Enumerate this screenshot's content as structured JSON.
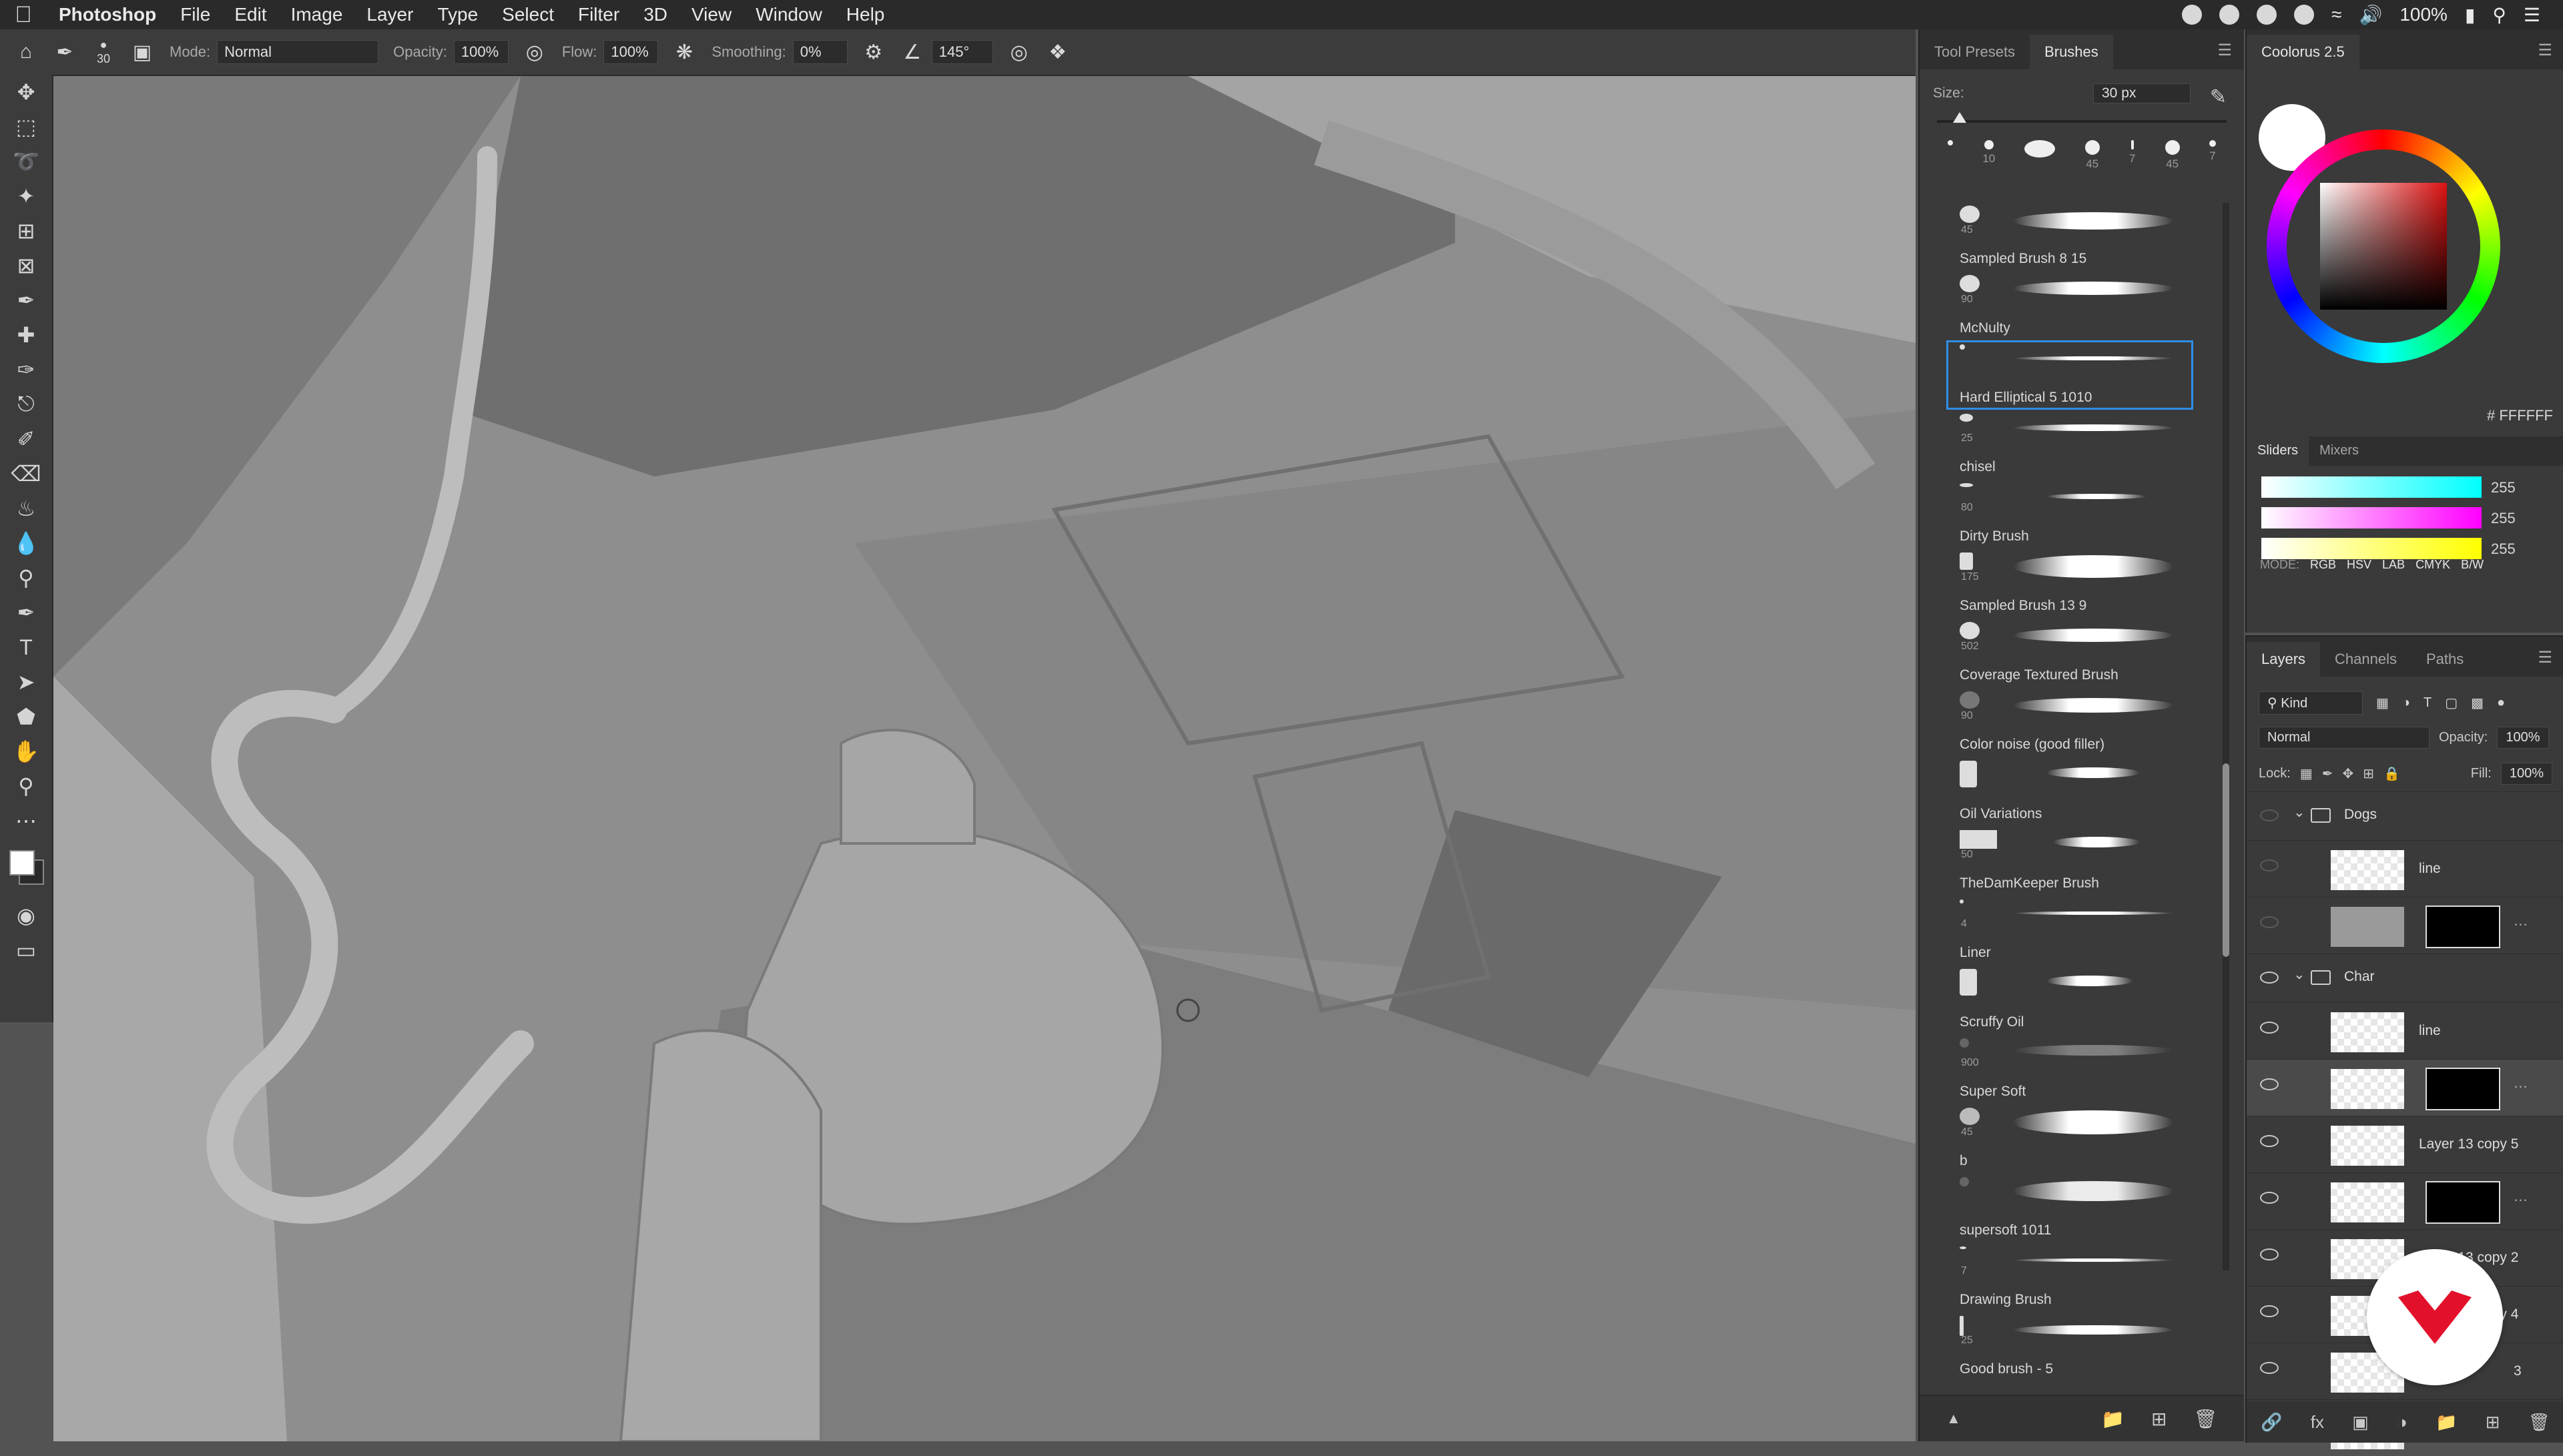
{
  "menubar": {
    "app": "Photoshop",
    "items": [
      "File",
      "Edit",
      "Image",
      "Layer",
      "Type",
      "Select",
      "Filter",
      "3D",
      "View",
      "Window",
      "Help"
    ],
    "battery": "100%"
  },
  "options": {
    "brush_size": "30",
    "mode_label": "Mode:",
    "mode": "Normal",
    "opacity_label": "Opacity:",
    "opacity": "100%",
    "flow_label": "Flow:",
    "flow": "100%",
    "smoothing_label": "Smoothing:",
    "smoothing": "0%",
    "angle": "145°"
  },
  "brushes_panel": {
    "tabs": [
      "Tool Presets",
      "Brushes"
    ],
    "size_label": "Size:",
    "size_value": "30 px",
    "tips": [
      "10",
      "45",
      "7",
      "45",
      "7"
    ],
    "items": [
      {
        "num": "45",
        "name": "Sampled Brush 8 15"
      },
      {
        "num": "90",
        "name": "McNulty"
      },
      {
        "num": "",
        "name": "Hard Elliptical 5 1010"
      },
      {
        "num": "25",
        "name": "chisel"
      },
      {
        "num": "80",
        "name": "Dirty Brush"
      },
      {
        "num": "175",
        "name": "Sampled Brush 13 9"
      },
      {
        "num": "502",
        "name": "Coverage Textured Brush"
      },
      {
        "num": "90",
        "name": "Color noise (good filler)"
      },
      {
        "num": "",
        "name": "Oil Variations"
      },
      {
        "num": "50",
        "name": "TheDamKeeper Brush"
      },
      {
        "num": "4",
        "name": "Liner"
      },
      {
        "num": "",
        "name": "Scruffy Oil"
      },
      {
        "num": "900",
        "name": "Super Soft"
      },
      {
        "num": "45",
        "name": "b"
      },
      {
        "num": "",
        "name": "supersoft 1011"
      },
      {
        "num": "7",
        "name": "Drawing Brush"
      },
      {
        "num": "25",
        "name": "Good brush - 5"
      }
    ]
  },
  "colour_panel": {
    "title": "Coolorus 2.5",
    "hex": "# FFFFFF",
    "subtabs": [
      "Sliders",
      "Mixers"
    ],
    "values": [
      "255",
      "255",
      "255"
    ],
    "mode_label": "MODE:",
    "modes": [
      "RGB",
      "HSV",
      "LAB",
      "CMYK",
      "B/W"
    ]
  },
  "layers_panel": {
    "tabs": [
      "Layers",
      "Channels",
      "Paths"
    ],
    "kind": "Kind",
    "blend": "Normal",
    "opacity_label": "Opacity:",
    "opacity": "100%",
    "lock_label": "Lock:",
    "fill_label": "Fill:",
    "fill": "100%",
    "group_dogs": "Dogs",
    "dogs_line": "line",
    "group_char": "Char",
    "char_line": "line",
    "l13c5": "Layer 13 copy 5",
    "l13c2": "Layer 13 copy 2",
    "l13c4": "Layer 13 copy 4",
    "l3_partial": "3"
  }
}
